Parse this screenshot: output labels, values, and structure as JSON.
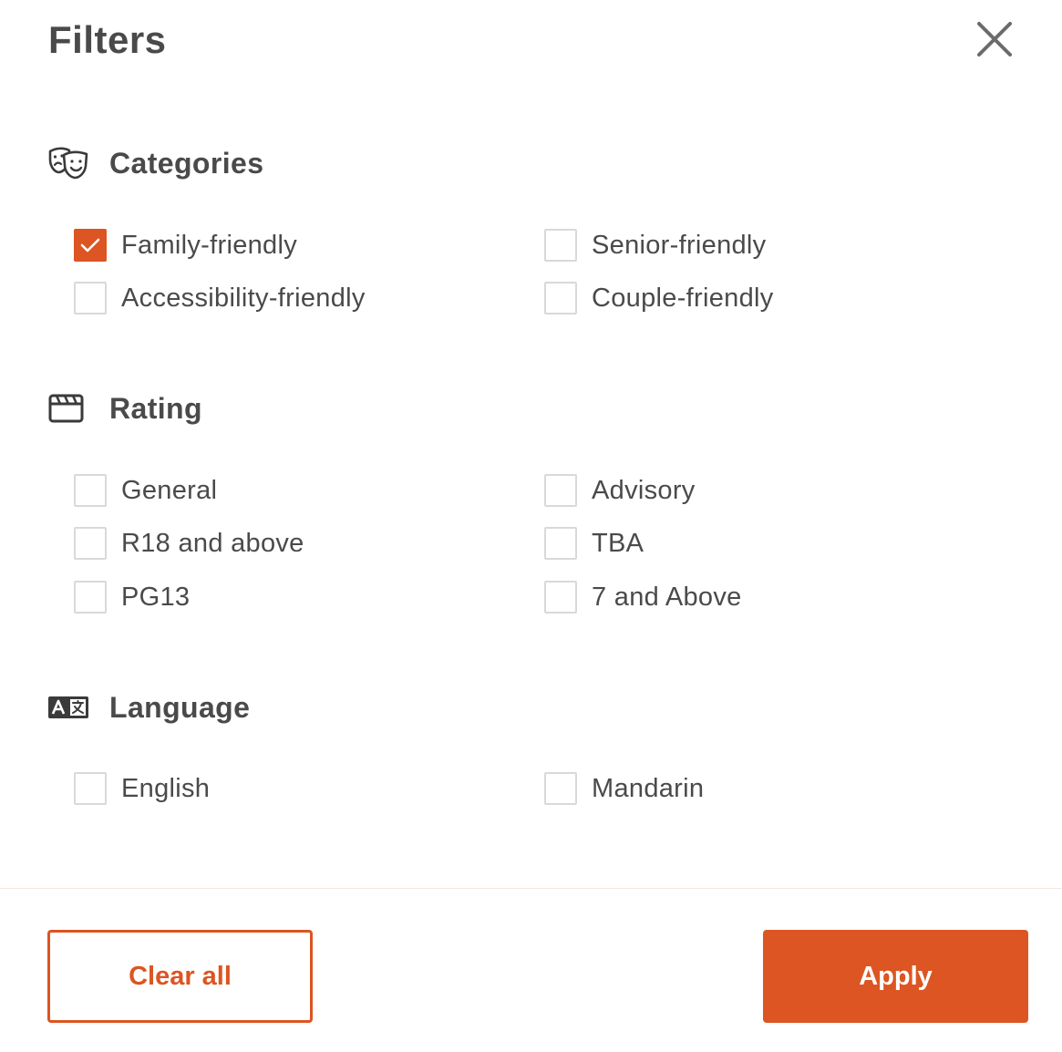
{
  "header": {
    "title": "Filters",
    "close_icon": "close-icon"
  },
  "colors": {
    "accent": "#dc5522",
    "text": "#4a4a4a",
    "checkbox_border": "#d9d9d9"
  },
  "categories": {
    "label": "Categories",
    "icon": "theater-masks-icon",
    "options": [
      {
        "label": "Family-friendly",
        "checked": true
      },
      {
        "label": "Senior-friendly",
        "checked": false
      },
      {
        "label": "Accessibility-friendly",
        "checked": false
      },
      {
        "label": "Couple-friendly",
        "checked": false
      }
    ]
  },
  "rating": {
    "label": "Rating",
    "icon": "clapperboard-icon",
    "options": [
      {
        "label": "General",
        "checked": false
      },
      {
        "label": "Advisory",
        "checked": false
      },
      {
        "label": "R18 and above",
        "checked": false
      },
      {
        "label": "TBA",
        "checked": false
      },
      {
        "label": "PG13",
        "checked": false
      },
      {
        "label": "7 and Above",
        "checked": false
      }
    ]
  },
  "language": {
    "label": "Language",
    "icon": "translate-icon",
    "options": [
      {
        "label": "English",
        "checked": false
      },
      {
        "label": "Mandarin",
        "checked": false
      }
    ]
  },
  "footer": {
    "clear_label": "Clear all",
    "apply_label": "Apply"
  }
}
